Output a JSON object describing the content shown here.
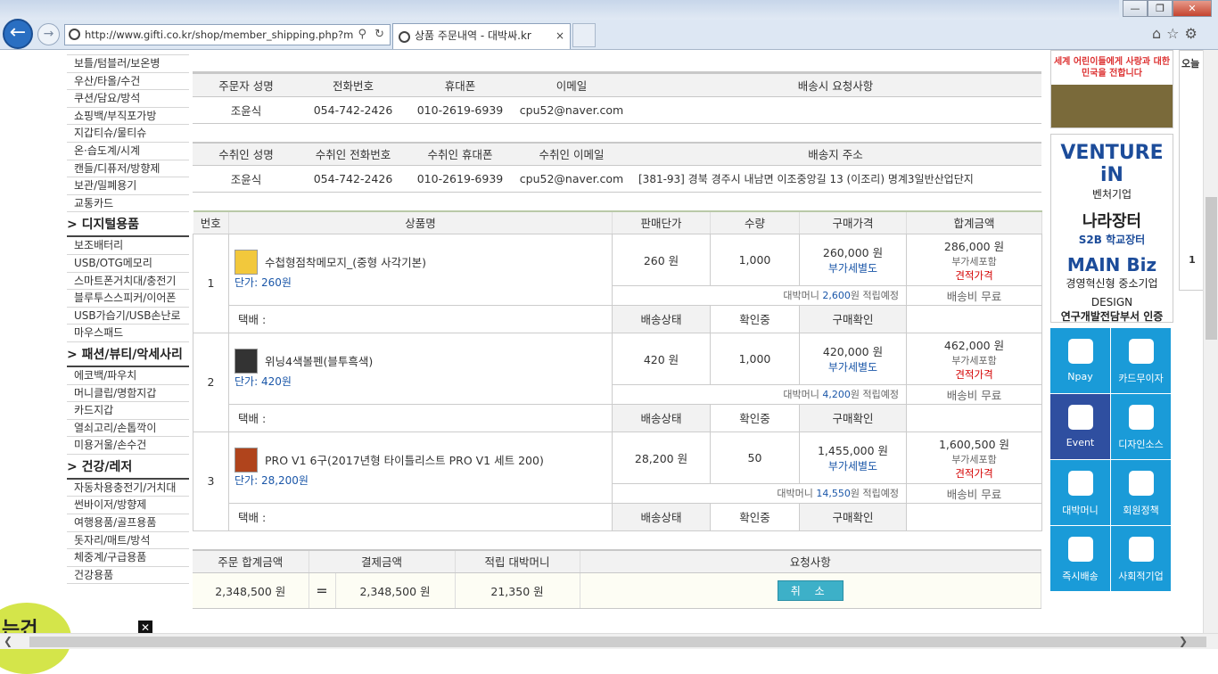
{
  "browser": {
    "url": "http://www.gifti.co.kr/shop/member_shipping.php?m",
    "tab_title": "상품 주문내역 - 대박싸.kr",
    "tab_close": "×"
  },
  "sidebar": {
    "group1": [
      "보틀/텀블러/보온병",
      "우산/타올/수건",
      "쿠션/담요/방석",
      "쇼핑백/부직포가방",
      "지갑티슈/물티슈",
      "온·습도계/시계",
      "캔들/디퓨저/방향제",
      "보관/밀폐용기",
      "교통카드"
    ],
    "head2": "디지털용품",
    "group2": [
      "보조배터리",
      "USB/OTG메모리",
      "스마트폰거치대/충전기",
      "블루투스스피커/이어폰",
      "USB가습기/USB손난로",
      "마우스패드"
    ],
    "head3": "패션/뷰티/악세사리",
    "group3": [
      "에코백/파우치",
      "머니클립/명함지갑",
      "카드지갑",
      "열쇠고리/손톱깍이",
      "미용거울/손수건"
    ],
    "head4": "건강/레저",
    "group4": [
      "자동차용충전기/거치대",
      "썬바이저/방향제",
      "여행용품/골프용품",
      "돗자리/매트/방석",
      "체중계/구급용품",
      "건강용품"
    ],
    "promo_text": "는건"
  },
  "orderer": {
    "headers": [
      "주문자 성명",
      "전화번호",
      "휴대폰",
      "이메일",
      "배송시 요청사항"
    ],
    "values": [
      "조윤식",
      "054-742-2426",
      "010-2619-6939",
      "cpu52@naver.com",
      ""
    ]
  },
  "receiver": {
    "headers": [
      "수취인 성명",
      "수취인 전화번호",
      "수취인 휴대폰",
      "수취인 이메일",
      "배송지 주소"
    ],
    "values": [
      "조윤식",
      "054-742-2426",
      "010-2619-6939",
      "cpu52@naver.com",
      "[381-93] 경북 경주시 내남면 이조중앙길 13 (이조리) 명계3일반산업단지"
    ]
  },
  "items_table": {
    "headers": [
      "번호",
      "상품명",
      "판매단가",
      "수량",
      "구매가격",
      "합계금액"
    ],
    "rows": [
      {
        "no": "1",
        "name": "수첩형점착메모지_(중형 사각기본)",
        "unit_price": "단가: 260원",
        "price": "260 원",
        "qty": "1,000",
        "purchase": "260,000 원",
        "vat_sep": "부가세별도",
        "total": "286,000 원",
        "vat_inc": "부가세포함",
        "estimate": "견적가격",
        "points_pre": "대박머니 ",
        "points": "2,600",
        "points_post": "원 적립예정",
        "ship_fee": "배송비 무료",
        "courier": "택배 :",
        "ship_status": "배송상태",
        "confirming": "확인중",
        "buy_confirm": "구매확인"
      },
      {
        "no": "2",
        "name": "위닝4색볼펜(블투흑색)",
        "unit_price": "단가: 420원",
        "price": "420 원",
        "qty": "1,000",
        "purchase": "420,000 원",
        "vat_sep": "부가세별도",
        "total": "462,000 원",
        "vat_inc": "부가세포함",
        "estimate": "견적가격",
        "points_pre": "대박머니 ",
        "points": "4,200",
        "points_post": "원 적립예정",
        "ship_fee": "배송비 무료",
        "courier": "택배 :",
        "ship_status": "배송상태",
        "confirming": "확인중",
        "buy_confirm": "구매확인"
      },
      {
        "no": "3",
        "name": "PRO V1 6구(2017년형 타이틀리스트 PRO V1 세트 200)",
        "unit_price": "단가: 28,200원",
        "price": "28,200 원",
        "qty": "50",
        "purchase": "1,455,000 원",
        "vat_sep": "부가세별도",
        "total": "1,600,500 원",
        "vat_inc": "부가세포함",
        "estimate": "견적가격",
        "points_pre": "대박머니 ",
        "points": "14,550",
        "points_post": "원 적립예정",
        "ship_fee": "배송비 무료",
        "courier": "택배 :",
        "ship_status": "배송상태",
        "confirming": "확인중",
        "buy_confirm": "구매확인"
      }
    ]
  },
  "summary": {
    "headers": [
      "주문 합계금액",
      "결제금액",
      "적립 대박머니",
      "요청사항"
    ],
    "order_total": "2,348,500 원",
    "equals": "=",
    "paid": "2,348,500 원",
    "points": "21,350 원",
    "cancel_label": "취 소"
  },
  "right": {
    "kids_banner": "세계 어린이들에게 사랑과 대한민국을 전합니다",
    "cert": [
      "VENTURE iN",
      "벤처기업",
      "나라장터",
      "S2B 학교장터",
      "MAIN Biz",
      "경영혁신형 중소기업",
      "DESIGN",
      "연구개발전담부서 인증"
    ],
    "tiles": [
      "Npay",
      "카드무이자",
      "Event",
      "디자인소스",
      "대박머니",
      "회원정책",
      "즉시배송",
      "사회적기업"
    ],
    "tile_colors": [
      "#1a9bd8",
      "#1a9bd8",
      "#2f4fa0",
      "#1a9bd8",
      "#1a9bd8",
      "#1a9bd8",
      "#1a9bd8",
      "#1a9bd8"
    ],
    "panel_text": "오늘",
    "panel_num": "1"
  }
}
